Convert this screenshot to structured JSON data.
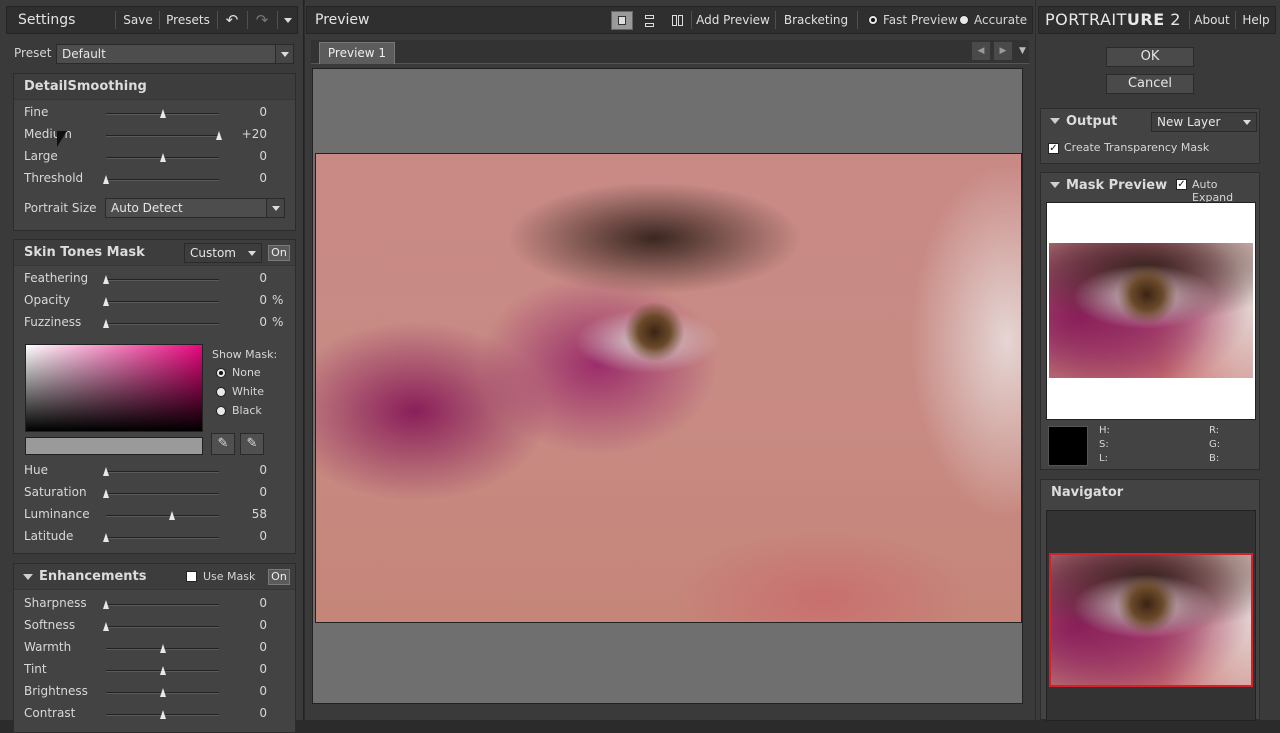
{
  "left": {
    "title": "Settings",
    "save": "Save",
    "presets": "Presets",
    "preset_label": "Preset",
    "preset_value": "Default",
    "detail": {
      "title": "DetailSmoothing",
      "sliders": [
        {
          "label": "Fine",
          "value": "0",
          "pos": 0.5
        },
        {
          "label": "Medium",
          "value": "+20",
          "pos": 1.0
        },
        {
          "label": "Large",
          "value": "0",
          "pos": 0.5
        },
        {
          "label": "Threshold",
          "value": "0",
          "pos": 0.0
        }
      ],
      "portrait_label": "Portrait Size",
      "portrait_value": "Auto Detect"
    },
    "skin": {
      "title": "Skin Tones Mask",
      "mode": "Custom",
      "on": "On",
      "sliders": [
        {
          "label": "Feathering",
          "value": "0",
          "unit": "",
          "pos": 0.0
        },
        {
          "label": "Opacity",
          "value": "0",
          "unit": "%",
          "pos": 0.0
        },
        {
          "label": "Fuzziness",
          "value": "0",
          "unit": "%",
          "pos": 0.0
        }
      ],
      "show_mask": "Show Mask:",
      "mask_options": [
        "None",
        "White",
        "Black"
      ],
      "mask_selected": "None",
      "sliders2": [
        {
          "label": "Hue",
          "value": "0",
          "pos": 0.0
        },
        {
          "label": "Saturation",
          "value": "0",
          "pos": 0.0
        },
        {
          "label": "Luminance",
          "value": "58",
          "pos": 0.58
        },
        {
          "label": "Latitude",
          "value": "0",
          "pos": 0.0
        }
      ]
    },
    "enh": {
      "title": "Enhancements",
      "use_mask": "Use Mask",
      "on": "On",
      "sliders": [
        {
          "label": "Sharpness",
          "value": "0",
          "pos": 0.0
        },
        {
          "label": "Softness",
          "value": "0",
          "pos": 0.0
        },
        {
          "label": "Warmth",
          "value": "0",
          "pos": 0.5
        },
        {
          "label": "Tint",
          "value": "0",
          "pos": 0.5
        },
        {
          "label": "Brightness",
          "value": "0",
          "pos": 0.5
        },
        {
          "label": "Contrast",
          "value": "0",
          "pos": 0.5
        }
      ]
    }
  },
  "center": {
    "title": "Preview",
    "add_preview": "Add Preview",
    "bracketing": "Bracketing",
    "fast_preview": "Fast Preview",
    "accurate": "Accurate",
    "tab": "Preview 1"
  },
  "right": {
    "brand_main": "PORTRAIT",
    "brand_bold": "URE",
    "brand_ver": "2",
    "about": "About",
    "help": "Help",
    "ok": "OK",
    "cancel": "Cancel",
    "output_title": "Output",
    "output_value": "New Layer",
    "transparency": "Create Transparency Mask",
    "mask_title": "Mask Preview",
    "auto_expand": "Auto Expand",
    "h": "H:",
    "s": "S:",
    "l": "L:",
    "r": "R:",
    "g": "G:",
    "b": "B:",
    "navigator": "Navigator"
  },
  "colors": {
    "accent_red": "#d2232a"
  }
}
